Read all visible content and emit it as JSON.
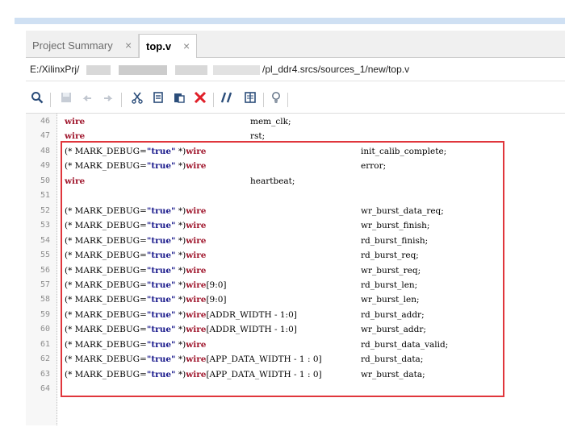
{
  "tabs": [
    {
      "label": "Project Summary",
      "close": "×"
    },
    {
      "label": "top.v",
      "close": "×"
    }
  ],
  "path": {
    "prefix": "E:/XilinxPrj/",
    "suffix": "/pl_ddr4.srcs/sources_1/new/top.v"
  },
  "toolbar": {
    "icons": [
      "search-icon",
      "save-icon",
      "back-icon",
      "forward-icon",
      "cut-icon",
      "copy-icon",
      "paste-icon",
      "delete-icon",
      "comment-icon",
      "column-icon",
      "lightbulb-icon"
    ]
  },
  "colors": {
    "keyword": "#a1192f",
    "string": "#1a1a8c",
    "highlight_box": "#e0363c"
  },
  "lines": [
    {
      "num": "46",
      "attr": "",
      "type": "wire",
      "range": "",
      "name": "mem_clk;"
    },
    {
      "num": "47",
      "attr": "",
      "type": "wire",
      "range": "",
      "name": "rst;"
    },
    {
      "num": "48",
      "attr": "(* MARK_DEBUG=",
      "val": "\"true\"",
      "tail": " *)",
      "type": "wire",
      "range": "",
      "name": "init_calib_complete;"
    },
    {
      "num": "49",
      "attr": "(* MARK_DEBUG=",
      "val": "\"true\"",
      "tail": " *)",
      "type": "wire",
      "range": "",
      "name": "error;"
    },
    {
      "num": "50",
      "attr": "",
      "type": "wire",
      "range": "",
      "name": "heartbeat;"
    },
    {
      "num": "51",
      "attr": "",
      "type": "",
      "range": "",
      "name": ""
    },
    {
      "num": "52",
      "attr": "(* MARK_DEBUG=",
      "val": "\"true\"",
      "tail": " *)",
      "type": "wire",
      "range": "",
      "name": "wr_burst_data_req;"
    },
    {
      "num": "53",
      "attr": "(* MARK_DEBUG=",
      "val": "\"true\"",
      "tail": " *)",
      "type": "wire",
      "range": "",
      "name": "wr_burst_finish;"
    },
    {
      "num": "54",
      "attr": "(* MARK_DEBUG=",
      "val": "\"true\"",
      "tail": " *)",
      "type": "wire",
      "range": "",
      "name": "rd_burst_finish;"
    },
    {
      "num": "55",
      "attr": "(* MARK_DEBUG=",
      "val": "\"true\"",
      "tail": " *)",
      "type": "wire",
      "range": "",
      "name": "rd_burst_req;"
    },
    {
      "num": "56",
      "attr": "(* MARK_DEBUG=",
      "val": "\"true\"",
      "tail": " *)",
      "type": "wire",
      "range": "",
      "name": "wr_burst_req;"
    },
    {
      "num": "57",
      "attr": "(* MARK_DEBUG=",
      "val": "\"true\"",
      "tail": " *)",
      "type": "wire",
      "range": "[9:0]",
      "name": "rd_burst_len;"
    },
    {
      "num": "58",
      "attr": "(* MARK_DEBUG=",
      "val": "\"true\"",
      "tail": " *)",
      "type": "wire",
      "range": "[9:0]",
      "name": "wr_burst_len;"
    },
    {
      "num": "59",
      "attr": "(* MARK_DEBUG=",
      "val": "\"true\"",
      "tail": " *)",
      "type": "wire",
      "range": "[ADDR_WIDTH - 1:0]",
      "name": "rd_burst_addr;"
    },
    {
      "num": "60",
      "attr": "(* MARK_DEBUG=",
      "val": "\"true\"",
      "tail": " *)",
      "type": "wire",
      "range": "[ADDR_WIDTH - 1:0]",
      "name": "wr_burst_addr;"
    },
    {
      "num": "61",
      "attr": "(* MARK_DEBUG=",
      "val": "\"true\"",
      "tail": " *)",
      "type": "wire",
      "range": "",
      "name": "rd_burst_data_valid;"
    },
    {
      "num": "62",
      "attr": "(* MARK_DEBUG=",
      "val": "\"true\"",
      "tail": " *)",
      "type": "wire",
      "range": "[APP_DATA_WIDTH - 1 : 0]",
      "name": "rd_burst_data;"
    },
    {
      "num": "63",
      "attr": "(* MARK_DEBUG=",
      "val": "\"true\"",
      "tail": " *)",
      "type": "wire",
      "range": "[APP_DATA_WIDTH - 1 : 0]",
      "name": "wr_burst_data;"
    },
    {
      "num": "64",
      "attr": "",
      "type": "",
      "range": "",
      "name": ""
    }
  ]
}
